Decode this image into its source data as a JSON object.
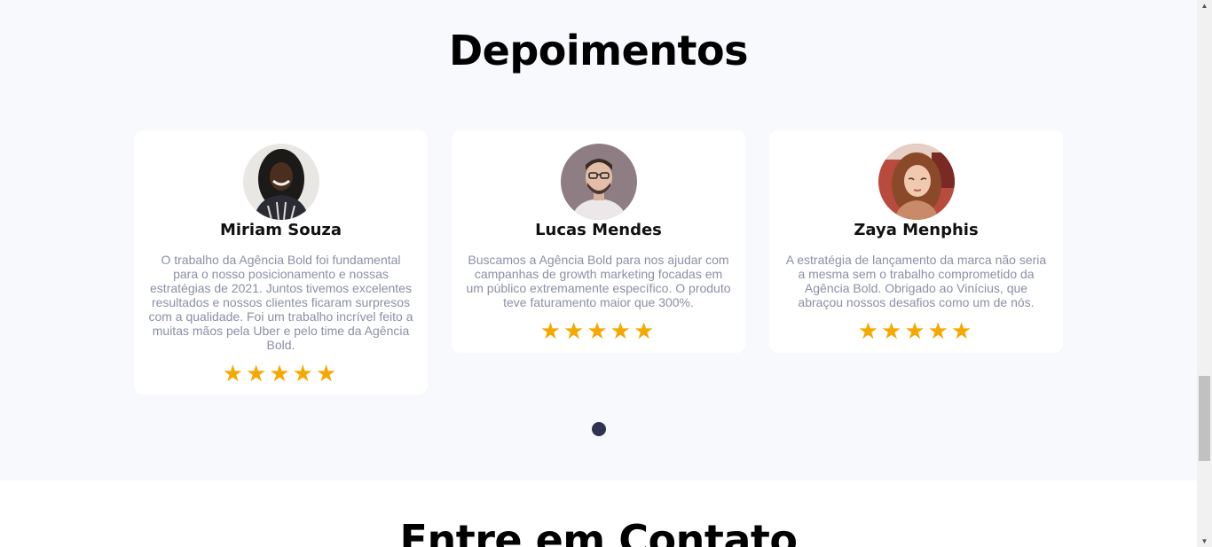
{
  "testimonials": {
    "title": "Depoimentos",
    "cards": [
      {
        "name": "Miriam Souza",
        "quote": "O trabalho da Agência Bold foi fundamental para o nosso posicionamento e nossas estratégias de 2021. Juntos tivemos excelentes resultados e nossos clientes ficaram surpresos com a qualidade. Foi um trabalho incrível feito a muitas mãos pela Uber e pelo time da Agência Bold.",
        "rating": 5,
        "stars": "★★★★★"
      },
      {
        "name": "Lucas Mendes",
        "quote": "Buscamos a Agência Bold para nos ajudar com campanhas de growth marketing focadas em um público extremamente específico. O produto teve faturamento maior que 300%.",
        "rating": 5,
        "stars": "★★★★★"
      },
      {
        "name": "Zaya Menphis",
        "quote": "A estratégia de lançamento da marca não seria a mesma sem o trabalho comprometido da Agência Bold. Obrigado ao Vinícius, que abraçou nossos desafios como um de nós.",
        "rating": 5,
        "stars": "★★★★★"
      }
    ],
    "carousel_pages": 1,
    "carousel_active": 1
  },
  "contact": {
    "title": "Entre em Contato"
  },
  "colors": {
    "section_bg": "#f8f9fd",
    "card_bg": "#ffffff",
    "star": "#f5a800",
    "quote_text": "#8a8fa6",
    "dot": "#2f3252"
  },
  "scrollbar": {
    "up_glyph": "▲",
    "down_glyph": "▼"
  }
}
